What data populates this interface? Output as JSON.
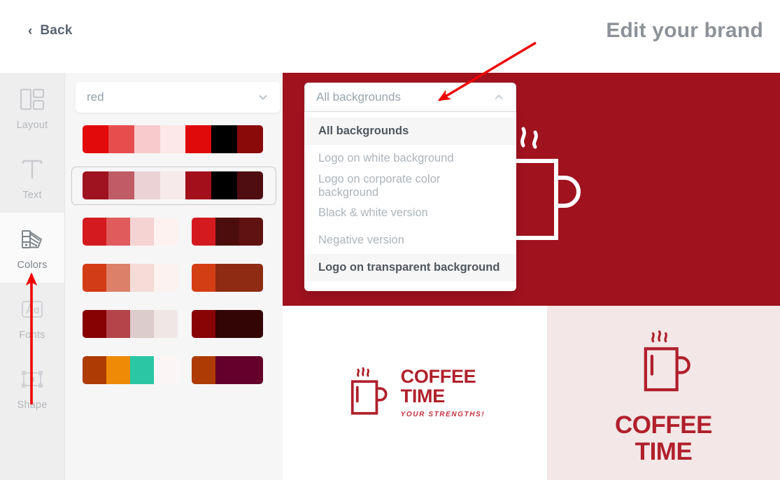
{
  "header": {
    "back_label": "Back",
    "back_icon": "chevron-left-icon",
    "title": "Edit your brand"
  },
  "sidebar": {
    "items": [
      {
        "label": "Layout",
        "icon": "layout-icon",
        "active": false
      },
      {
        "label": "Text",
        "icon": "text-t-icon",
        "active": false
      },
      {
        "label": "Colors",
        "icon": "color-fan-icon",
        "active": true
      },
      {
        "label": "Fonts",
        "icon": "fonts-aa-icon",
        "active": false
      },
      {
        "label": "Shape",
        "icon": "shape-box-icon",
        "active": false
      }
    ]
  },
  "palette_panel": {
    "brand_select": {
      "value": "red",
      "placeholder": "red",
      "icon": "chevron-down-icon"
    },
    "rows": [
      {
        "selected": false,
        "groups": [
          {
            "colors": [
              "#E20A0A",
              "#E84D4D",
              "#F7CBCB",
              "#FCE8E8",
              "#E00A0A",
              "#000000",
              "#8A0A0A"
            ]
          }
        ]
      },
      {
        "selected": true,
        "groups": [
          {
            "colors": [
              "#9E131F",
              "#BF5C66",
              "#EBD2D4",
              "#F6EAEB",
              "#A3101C",
              "#000000",
              "#4F0D12"
            ]
          }
        ]
      },
      {
        "selected": false,
        "groups": [
          {
            "colors": [
              "#D41A1F",
              "#E05B5B",
              "#F6D3D3",
              "#FDF2F0"
            ]
          },
          {
            "colors": [
              "#D41A1F",
              "#4C0E0C",
              "#601210"
            ]
          }
        ]
      },
      {
        "selected": false,
        "groups": [
          {
            "colors": [
              "#D23C16",
              "#DD8069",
              "#F5DCD6",
              "#FCF2EF"
            ]
          },
          {
            "colors": [
              "#D43E14",
              "#8E2B12",
              "#8E2B12"
            ]
          }
        ]
      },
      {
        "selected": false,
        "groups": [
          {
            "colors": [
              "#870303",
              "#B5444A",
              "#DCCCCB",
              "#EFE7E6"
            ]
          },
          {
            "colors": [
              "#880405",
              "#330504",
              "#330504"
            ]
          }
        ]
      },
      {
        "selected": false,
        "groups": [
          {
            "colors": [
              "#AE3B03",
              "#EE8A06",
              "#2BC7A5",
              "#FBF6F5"
            ]
          },
          {
            "colors": [
              "#AE3B03",
              "#640029",
              "#640029"
            ]
          }
        ]
      }
    ]
  },
  "background_dropdown": {
    "selected_label": "All backgrounds",
    "caret_icon": "chevron-up-icon",
    "options": [
      {
        "label": "All backgrounds",
        "highlight": true
      },
      {
        "label": "Logo on white background",
        "highlight": false
      },
      {
        "label": "Logo on corporate color background",
        "highlight": false
      },
      {
        "label": "Black & white version",
        "highlight": false
      },
      {
        "label": "Negative version",
        "highlight": false
      },
      {
        "label": "Logo on transparent background",
        "highlight": true
      }
    ]
  },
  "preview": {
    "brand_red": "#A0121E",
    "logo_red": "#B0202C",
    "pink_bg": "#F3E7E7",
    "white_bg": "#FFFFFF",
    "tiles": [
      {
        "name": "logo-on-corporate-color-background",
        "bg": "#A0121E",
        "mark_color": "#FFFFFF",
        "wordmark": "",
        "line1": "",
        "line2": "",
        "tagline": ""
      },
      {
        "name": "logo-on-white-background",
        "bg": "#FFFFFF",
        "mark_color": "#B0202C",
        "wordmark": "horizontal",
        "line1": "COFFEE",
        "line2": "TIME",
        "tagline": "YOUR STRENGTHS!"
      },
      {
        "name": "logo-on-transparent-background",
        "bg": "#F3E7E7",
        "mark_color": "#B0202C",
        "wordmark": "stacked",
        "line1": "COFFEE",
        "line2": "TIME",
        "tagline": ""
      }
    ]
  },
  "annotations": {
    "arrow_color": "#F00000",
    "arrow_to_dropdown": {
      "name": "arrow-pointing-to-background-dropdown"
    },
    "arrow_to_colors": {
      "name": "arrow-pointing-to-colors-tab"
    }
  }
}
